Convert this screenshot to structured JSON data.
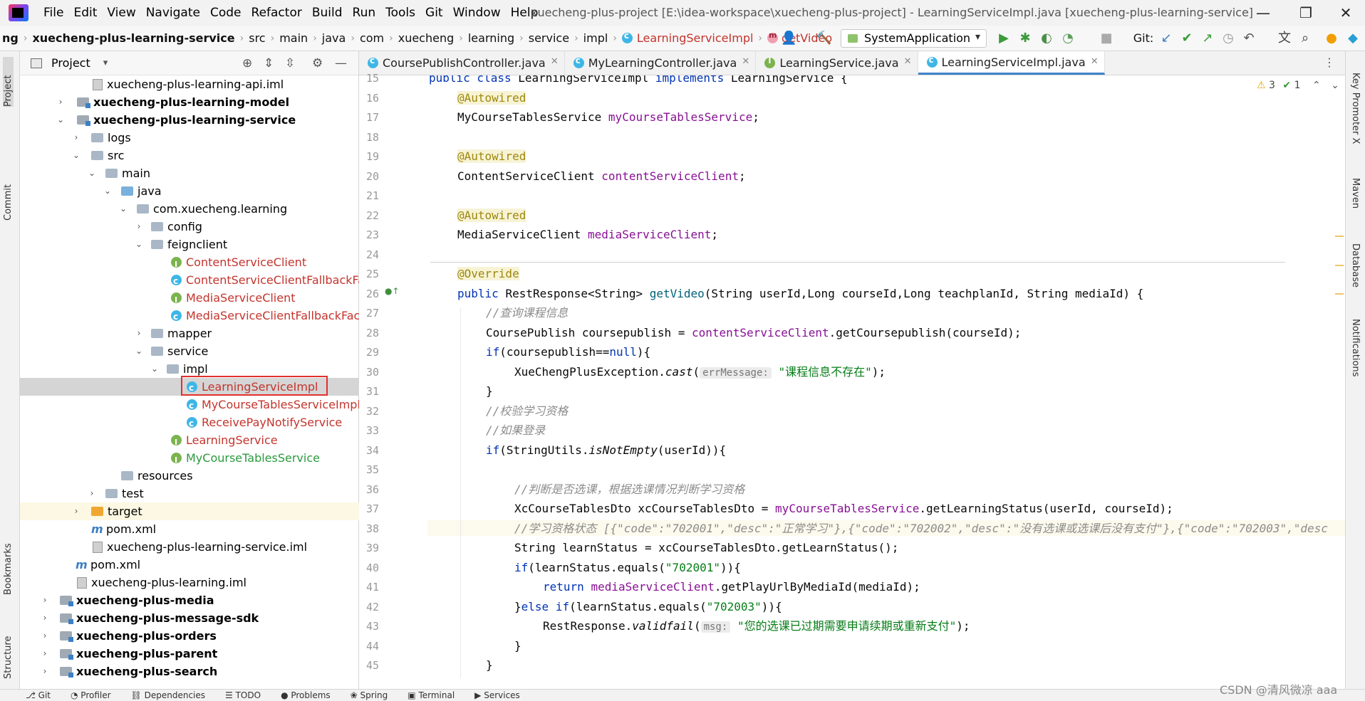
{
  "window": {
    "title": "xuecheng-plus-project [E:\\idea-workspace\\xuecheng-plus-project] - LearningServiceImpl.java [xuecheng-plus-learning-service]",
    "minimize": "—",
    "maximize": "❐",
    "close": "✕"
  },
  "menu": [
    "File",
    "Edit",
    "View",
    "Navigate",
    "Code",
    "Refactor",
    "Build",
    "Run",
    "Tools",
    "Git",
    "Window",
    "Help"
  ],
  "breadcrumb": [
    "ng",
    "xuecheng-plus-learning-service",
    "src",
    "main",
    "java",
    "com",
    "xuecheng",
    "learning",
    "service",
    "impl",
    "LearningServiceImpl",
    "getVideo"
  ],
  "toolbar": {
    "run_config": "SystemApplication",
    "git_label": "Git:"
  },
  "project_panel": {
    "title": "Project",
    "dropdown": "▾"
  },
  "tree": [
    {
      "label": "xuecheng-plus-learning-api.iml",
      "icon": "iml-icon",
      "color": "normal"
    },
    {
      "label": "xuecheng-plus-learning-model",
      "icon": "module-folder-icon",
      "color": "bold"
    },
    {
      "label": "xuecheng-plus-learning-service",
      "icon": "module-folder-icon",
      "color": "bold"
    },
    {
      "label": "logs",
      "icon": "folder-icon",
      "color": "normal"
    },
    {
      "label": "src",
      "icon": "folder-icon",
      "color": "normal"
    },
    {
      "label": "main",
      "icon": "folder-icon",
      "color": "normal"
    },
    {
      "label": "java",
      "icon": "source-folder-icon",
      "color": "normal"
    },
    {
      "label": "com.xuecheng.learning",
      "icon": "package-icon",
      "color": "normal"
    },
    {
      "label": "config",
      "icon": "package-icon",
      "color": "normal"
    },
    {
      "label": "feignclient",
      "icon": "package-icon",
      "color": "normal"
    },
    {
      "label": "ContentServiceClient",
      "icon": "interface-icon",
      "color": "red"
    },
    {
      "label": "ContentServiceClientFallbackFact",
      "icon": "class-icon",
      "color": "red"
    },
    {
      "label": "MediaServiceClient",
      "icon": "interface-icon",
      "color": "red"
    },
    {
      "label": "MediaServiceClientFallbackFactor",
      "icon": "class-icon",
      "color": "red"
    },
    {
      "label": "mapper",
      "icon": "package-icon",
      "color": "normal"
    },
    {
      "label": "service",
      "icon": "package-icon",
      "color": "normal"
    },
    {
      "label": "impl",
      "icon": "package-icon",
      "color": "normal"
    },
    {
      "label": "LearningServiceImpl",
      "icon": "class-icon",
      "color": "red"
    },
    {
      "label": "MyCourseTablesServiceImpl",
      "icon": "class-icon",
      "color": "red"
    },
    {
      "label": "ReceivePayNotifyService",
      "icon": "class-icon",
      "color": "red"
    },
    {
      "label": "LearningService",
      "icon": "interface-icon",
      "color": "red"
    },
    {
      "label": "MyCourseTablesService",
      "icon": "interface-icon",
      "color": "green"
    },
    {
      "label": "resources",
      "icon": "resources-folder-icon",
      "color": "normal"
    },
    {
      "label": "test",
      "icon": "folder-icon",
      "color": "normal"
    },
    {
      "label": "target",
      "icon": "excluded-folder-icon",
      "color": "normal"
    },
    {
      "label": "pom.xml",
      "icon": "maven-icon",
      "color": "normal"
    },
    {
      "label": "xuecheng-plus-learning-service.iml",
      "icon": "iml-icon",
      "color": "normal"
    },
    {
      "label": "pom.xml",
      "icon": "maven-icon",
      "color": "normal"
    },
    {
      "label": "xuecheng-plus-learning.iml",
      "icon": "iml-icon",
      "color": "normal"
    },
    {
      "label": "xuecheng-plus-media",
      "icon": "module-folder-icon",
      "color": "bold"
    },
    {
      "label": "xuecheng-plus-message-sdk",
      "icon": "module-folder-icon",
      "color": "bold"
    },
    {
      "label": "xuecheng-plus-orders",
      "icon": "module-folder-icon",
      "color": "bold"
    },
    {
      "label": "xuecheng-plus-parent",
      "icon": "module-folder-icon",
      "color": "bold"
    },
    {
      "label": "xuecheng-plus-search",
      "icon": "module-folder-icon",
      "color": "bold"
    }
  ],
  "editor_tabs": [
    {
      "label": "CoursePublishController.java",
      "icon": "class-icon"
    },
    {
      "label": "MyLearningController.java",
      "icon": "class-icon"
    },
    {
      "label": "LearningService.java",
      "icon": "interface-icon"
    },
    {
      "label": "LearningServiceImpl.java",
      "icon": "class-icon",
      "active": true
    }
  ],
  "line_numbers": [
    "15",
    "16",
    "17",
    "18",
    "19",
    "20",
    "21",
    "22",
    "23",
    "24",
    "25",
    "26",
    "27",
    "28",
    "29",
    "30",
    "31",
    "32",
    "33",
    "34",
    "35",
    "36",
    "37",
    "38",
    "39",
    "40",
    "41",
    "42",
    "43",
    "44",
    "45"
  ],
  "code": {
    "l15a": "public class ",
    "l15b": "LearningServiceImpl ",
    "l15c": "implements ",
    "l15d": "LearningService {",
    "ann_autowired": "@Autowired",
    "l17a": "MyCourseTablesService ",
    "l17b": "myCourseTablesService",
    "semi": ";",
    "l20a": "ContentServiceClient ",
    "l20b": "contentServiceClient",
    "l23a": "MediaServiceClient ",
    "l23b": "mediaServiceClient",
    "l25": "@Override",
    "l26a": "public ",
    "l26b": "RestResponse<String> ",
    "l26c": "getVideo",
    "l26d": "(String userId,Long courseId,Long teachplanId, String mediaId) {",
    "l27": "//查询课程信息",
    "l28a": "CoursePublish coursepublish = ",
    "l28b": "contentServiceClient",
    "l28c": ".getCoursepublish(courseId);",
    "l29a": "if",
    "l29b": "(coursepublish==",
    "l29c": "null",
    "l29d": "){",
    "l30a": "XueChengPlusException.",
    "l30b": "cast",
    "l30c": "(",
    "l30hint": "errMessage:",
    "l30d": "\"课程信息不存在\"",
    "l30e": ");",
    "l31": "}",
    "l32": "//校验学习资格",
    "l33": "//如果登录",
    "l34a": "if",
    "l34b": "(StringUtils.",
    "l34c": "isNotEmpty",
    "l34d": "(userId)){",
    "l36": "//判断是否选课，根据选课情况判断学习资格",
    "l37a": "XcCourseTablesDto xcCourseTablesDto = ",
    "l37b": "myCourseTablesService",
    "l37c": ".getLearningStatus(userId, courseId);",
    "l38": "//学习资格状态 [{\"code\":\"702001\",\"desc\":\"正常学习\"},{\"code\":\"702002\",\"desc\":\"没有选课或选课后没有支付\"},{\"code\":\"702003\",\"desc",
    "l39": "String learnStatus = xcCourseTablesDto.getLearnStatus();",
    "l40a": "if",
    "l40b": "(learnStatus.equals(",
    "l40c": "\"702001\"",
    "l40d": ")){",
    "l41a": "return ",
    "l41b": "mediaServiceClient",
    "l41c": ".getPlayUrlByMediaId(mediaId);",
    "l42a": "}",
    "l42b": "else ",
    "l42c": "if",
    "l42d": "(learnStatus.equals(",
    "l42e": "\"702003\"",
    "l42f": ")){",
    "l43a": "RestResponse.",
    "l43b": "validfail",
    "l43c": "(",
    "l43hint": "msg:",
    "l43d": "\"您的选课已过期需要申请续期或重新支付\"",
    "l43e": ");",
    "l44": "}",
    "l45": "}"
  },
  "inspections": {
    "warnings": "3",
    "ok": "1"
  },
  "left_tools": [
    "Project",
    "Commit",
    "Bookmarks",
    "Structure"
  ],
  "right_tools": [
    "Key Promoter X",
    "Maven",
    "Database",
    "Notifications"
  ],
  "bottom_tools": [
    "Git",
    "Profiler",
    "Dependencies",
    "TODO",
    "Problems",
    "Spring",
    "Terminal",
    "Services"
  ],
  "watermark": "CSDN @清风微凉 aaa"
}
